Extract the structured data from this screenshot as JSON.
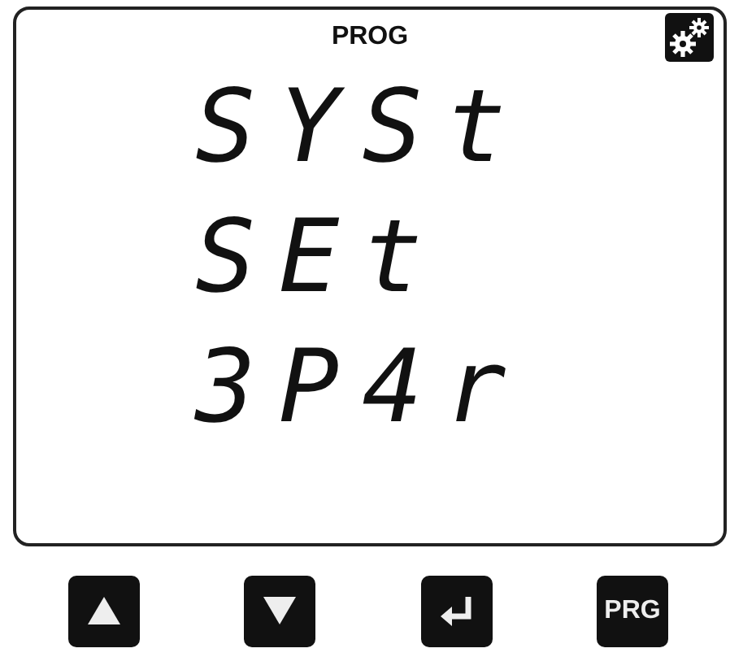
{
  "display": {
    "mode_label": "PROG",
    "lines": [
      "SYSt",
      "SEt",
      "3P4r"
    ]
  },
  "buttons": [
    {
      "kind": "up"
    },
    {
      "kind": "down"
    },
    {
      "kind": "enter"
    },
    {
      "kind": "text",
      "label": "PRG"
    }
  ]
}
